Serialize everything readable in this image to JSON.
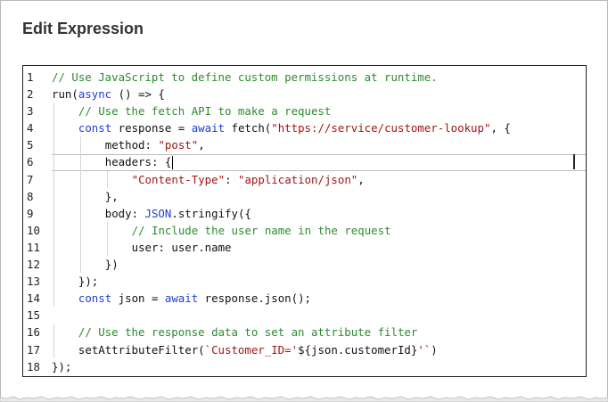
{
  "dialog": {
    "title": "Edit Expression"
  },
  "editor": {
    "active_line": 6,
    "lines": [
      {
        "n": "1",
        "indent": 0,
        "tokens": [
          {
            "t": "// Use JavaScript to define custom permissions at runtime.",
            "c": "comment"
          }
        ]
      },
      {
        "n": "2",
        "indent": 0,
        "tokens": [
          {
            "t": "run(",
            "c": "plain"
          },
          {
            "t": "async",
            "c": "keyword"
          },
          {
            "t": " () => {",
            "c": "plain"
          }
        ]
      },
      {
        "n": "3",
        "indent": 1,
        "tokens": [
          {
            "t": "// Use the fetch API to make a request",
            "c": "comment"
          }
        ]
      },
      {
        "n": "4",
        "indent": 1,
        "tokens": [
          {
            "t": "const",
            "c": "keyword"
          },
          {
            "t": " response = ",
            "c": "plain"
          },
          {
            "t": "await",
            "c": "keyword"
          },
          {
            "t": " fetch(",
            "c": "plain"
          },
          {
            "t": "\"https://service/customer-lookup\"",
            "c": "string"
          },
          {
            "t": ", {",
            "c": "plain"
          }
        ]
      },
      {
        "n": "5",
        "indent": 2,
        "tokens": [
          {
            "t": "method: ",
            "c": "plain"
          },
          {
            "t": "\"post\"",
            "c": "string"
          },
          {
            "t": ",",
            "c": "plain"
          }
        ]
      },
      {
        "n": "6",
        "indent": 2,
        "tokens": [
          {
            "t": "headers: {",
            "c": "plain"
          }
        ],
        "cursor": true
      },
      {
        "n": "7",
        "indent": 3,
        "tokens": [
          {
            "t": "\"Content-Type\"",
            "c": "string"
          },
          {
            "t": ": ",
            "c": "plain"
          },
          {
            "t": "\"application/json\"",
            "c": "string"
          },
          {
            "t": ",",
            "c": "plain"
          }
        ]
      },
      {
        "n": "8",
        "indent": 2,
        "tokens": [
          {
            "t": "},",
            "c": "plain"
          }
        ]
      },
      {
        "n": "9",
        "indent": 2,
        "tokens": [
          {
            "t": "body: ",
            "c": "plain"
          },
          {
            "t": "JSON",
            "c": "type"
          },
          {
            "t": ".stringify({",
            "c": "plain"
          }
        ]
      },
      {
        "n": "10",
        "indent": 3,
        "tokens": [
          {
            "t": "// Include the user name in the request",
            "c": "comment"
          }
        ]
      },
      {
        "n": "11",
        "indent": 3,
        "tokens": [
          {
            "t": "user: user.name",
            "c": "plain"
          }
        ]
      },
      {
        "n": "12",
        "indent": 2,
        "tokens": [
          {
            "t": "})",
            "c": "plain"
          }
        ]
      },
      {
        "n": "13",
        "indent": 1,
        "tokens": [
          {
            "t": "});",
            "c": "plain"
          }
        ]
      },
      {
        "n": "14",
        "indent": 1,
        "tokens": [
          {
            "t": "const",
            "c": "keyword"
          },
          {
            "t": " json = ",
            "c": "plain"
          },
          {
            "t": "await",
            "c": "keyword"
          },
          {
            "t": " response.json();",
            "c": "plain"
          }
        ]
      },
      {
        "n": "15",
        "indent": 0,
        "tokens": []
      },
      {
        "n": "16",
        "indent": 1,
        "tokens": [
          {
            "t": "// Use the response data to set an attribute filter",
            "c": "comment"
          }
        ]
      },
      {
        "n": "17",
        "indent": 1,
        "tokens": [
          {
            "t": "setAttributeFilter(",
            "c": "plain"
          },
          {
            "t": "`Customer_ID='",
            "c": "string"
          },
          {
            "t": "${json.customerId}",
            "c": "plain"
          },
          {
            "t": "'`",
            "c": "string"
          },
          {
            "t": ")",
            "c": "plain"
          }
        ]
      },
      {
        "n": "18",
        "indent": 0,
        "tokens": [
          {
            "t": "});",
            "c": "plain"
          }
        ]
      }
    ]
  }
}
